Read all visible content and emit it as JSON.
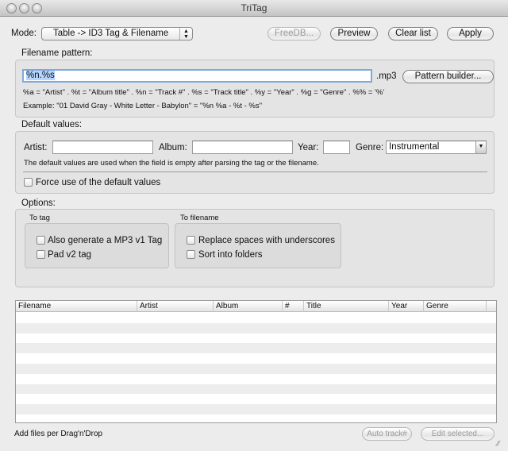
{
  "window": {
    "title": "TriTag"
  },
  "toolbar": {
    "mode_label": "Mode:",
    "mode_value": "Table -> ID3 Tag & Filename",
    "freedb": "FreeDB...",
    "preview": "Preview",
    "clear_list": "Clear list",
    "apply": "Apply"
  },
  "pattern": {
    "section": "Filename pattern:",
    "value": "%n.%s",
    "extension": ".mp3",
    "builder": "Pattern builder...",
    "legend": "%a = \"Artist\" . %t = \"Album title\" . %n = \"Track #\" . %s = \"Track title\" . %y = \"Year\"  . %g = \"Genre\" . %% = '%'",
    "example": "Example: \"01 David Gray - White Letter - Babylon\" = \"%n %a - %t - %s\""
  },
  "defaults": {
    "section": "Default values:",
    "artist_label": "Artist:",
    "artist": "",
    "album_label": "Album:",
    "album": "",
    "year_label": "Year:",
    "year": "",
    "genre_label": "Genre:",
    "genre": "Instrumental",
    "note": "The default values are used when the field is empty after parsing the tag or the filename.",
    "force": "Force use of the default values",
    "force_checked": false
  },
  "options": {
    "section": "Options:",
    "to_tag": {
      "title": "To tag",
      "v1": "Also generate a MP3 v1 Tag",
      "v1_checked": false,
      "pad": "Pad v2 tag",
      "pad_checked": false
    },
    "to_filename": {
      "title": "To filename",
      "underscores": "Replace spaces with underscores",
      "underscores_checked": false,
      "folders": "Sort into folders",
      "folders_checked": false
    }
  },
  "table": {
    "columns": [
      "Filename",
      "Artist",
      "Album",
      "#",
      "Title",
      "Year",
      "Genre"
    ],
    "rows": []
  },
  "footer": {
    "hint": "Add files per Drag'n'Drop",
    "auto_track": "Auto track#",
    "edit_selected": "Edit selected..."
  }
}
